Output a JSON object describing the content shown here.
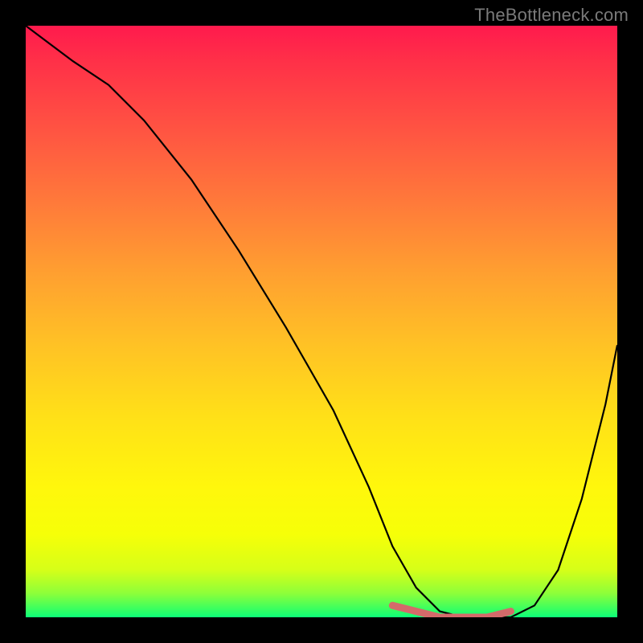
{
  "attribution": "TheBottleneck.com",
  "chart_data": {
    "type": "line",
    "title": "",
    "xlabel": "",
    "ylabel": "",
    "xlim": [
      0,
      100
    ],
    "ylim": [
      0,
      100
    ],
    "background_gradient": {
      "type": "vertical",
      "stops": [
        {
          "pos": 0,
          "color": "#ff1a4d"
        },
        {
          "pos": 18,
          "color": "#ff5542"
        },
        {
          "pos": 42,
          "color": "#ffa030"
        },
        {
          "pos": 66,
          "color": "#ffe018"
        },
        {
          "pos": 86,
          "color": "#f6ff08"
        },
        {
          "pos": 96,
          "color": "#8cff3a"
        },
        {
          "pos": 100,
          "color": "#0cff7a"
        }
      ]
    },
    "series": [
      {
        "name": "bottleneck-curve",
        "color": "#000000",
        "x": [
          0,
          4,
          8,
          14,
          20,
          28,
          36,
          44,
          52,
          58,
          62,
          66,
          70,
          74,
          78,
          82,
          86,
          90,
          94,
          98,
          100
        ],
        "values": [
          100,
          97,
          94,
          90,
          84,
          74,
          62,
          49,
          35,
          22,
          12,
          5,
          1,
          0,
          0,
          0,
          2,
          8,
          20,
          36,
          46
        ]
      },
      {
        "name": "optimal-band",
        "color": "#d46a6a",
        "x": [
          62,
          66,
          70,
          74,
          78,
          82
        ],
        "values": [
          2,
          1,
          0,
          0,
          0,
          1
        ]
      }
    ]
  }
}
